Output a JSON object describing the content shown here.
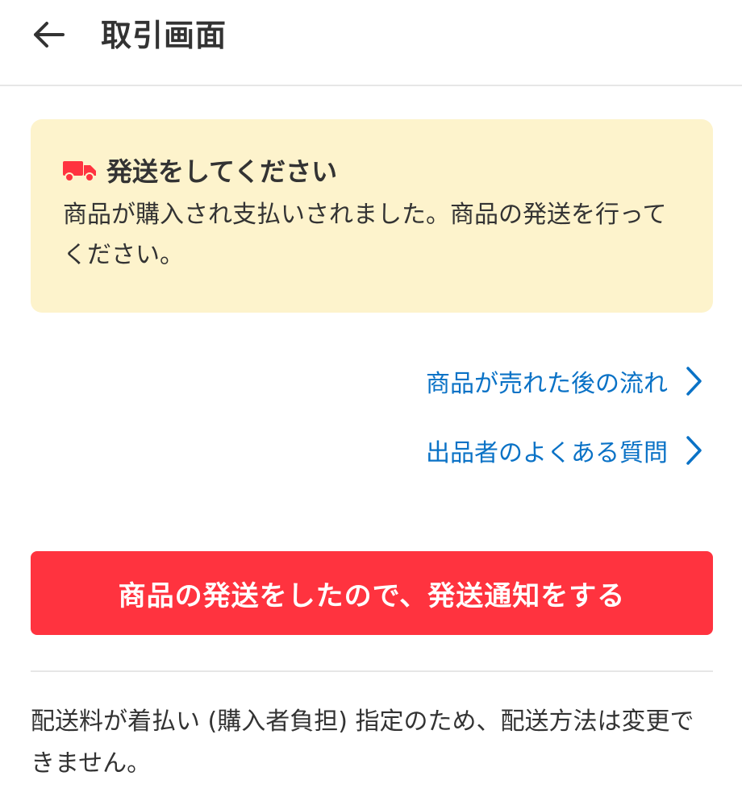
{
  "header": {
    "title": "取引画面"
  },
  "notice": {
    "title": "発送をしてください",
    "body": "商品が購入され支払いされました。商品の発送を行ってください。",
    "icon": "truck-icon",
    "accent": "#ff333f",
    "background": "#fdf3cc"
  },
  "links": [
    {
      "label": "商品が売れた後の流れ"
    },
    {
      "label": "出品者のよくある質問"
    }
  ],
  "cta": {
    "label": "商品の発送をしたので、発送通知をする",
    "color": "#ff333f"
  },
  "footnote": {
    "text": "配送料が着払い (購入者負担) 指定のため、配送方法は変更できません。"
  }
}
